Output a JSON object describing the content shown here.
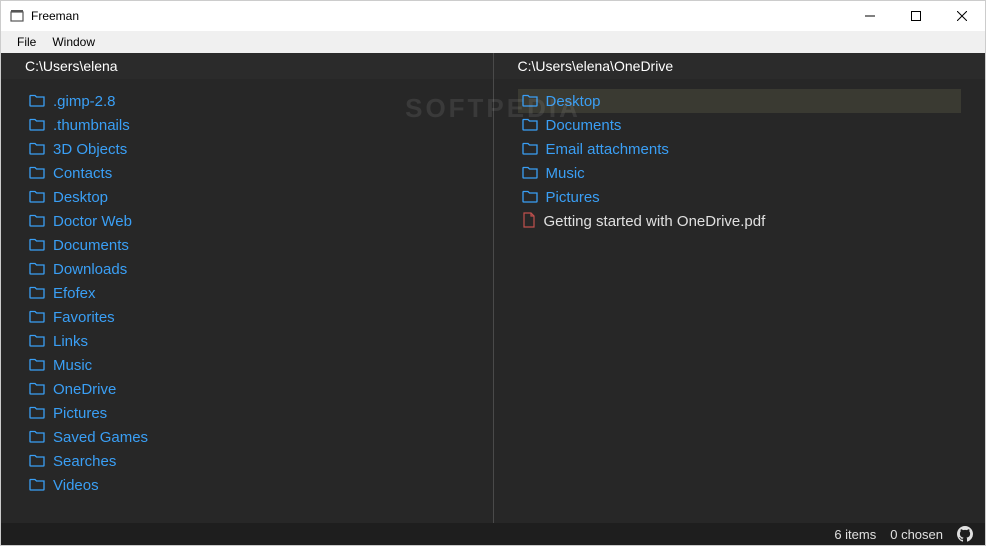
{
  "window": {
    "title": "Freeman"
  },
  "menu": {
    "items": [
      "File",
      "Window"
    ]
  },
  "panes": {
    "left": {
      "path": "C:\\Users\\elena",
      "entries": [
        {
          "type": "folder",
          "name": ".gimp-2.8"
        },
        {
          "type": "folder",
          "name": ".thumbnails"
        },
        {
          "type": "folder",
          "name": "3D Objects"
        },
        {
          "type": "folder",
          "name": "Contacts"
        },
        {
          "type": "folder",
          "name": "Desktop"
        },
        {
          "type": "folder",
          "name": "Doctor Web"
        },
        {
          "type": "folder",
          "name": "Documents"
        },
        {
          "type": "folder",
          "name": "Downloads"
        },
        {
          "type": "folder",
          "name": "Efofex"
        },
        {
          "type": "folder",
          "name": "Favorites"
        },
        {
          "type": "folder",
          "name": "Links"
        },
        {
          "type": "folder",
          "name": "Music"
        },
        {
          "type": "folder",
          "name": "OneDrive"
        },
        {
          "type": "folder",
          "name": "Pictures"
        },
        {
          "type": "folder",
          "name": "Saved Games"
        },
        {
          "type": "folder",
          "name": "Searches"
        },
        {
          "type": "folder",
          "name": "Videos"
        }
      ]
    },
    "right": {
      "path": "C:\\Users\\elena\\OneDrive",
      "selected_index": 0,
      "entries": [
        {
          "type": "folder",
          "name": "Desktop"
        },
        {
          "type": "folder",
          "name": "Documents"
        },
        {
          "type": "folder",
          "name": "Email attachments"
        },
        {
          "type": "folder",
          "name": "Music"
        },
        {
          "type": "folder",
          "name": "Pictures"
        },
        {
          "type": "file",
          "name": "Getting started with OneDrive.pdf"
        }
      ]
    }
  },
  "status": {
    "items_label": "6 items",
    "chosen_label": "0 chosen"
  },
  "watermark": "SOFTPEDIA"
}
